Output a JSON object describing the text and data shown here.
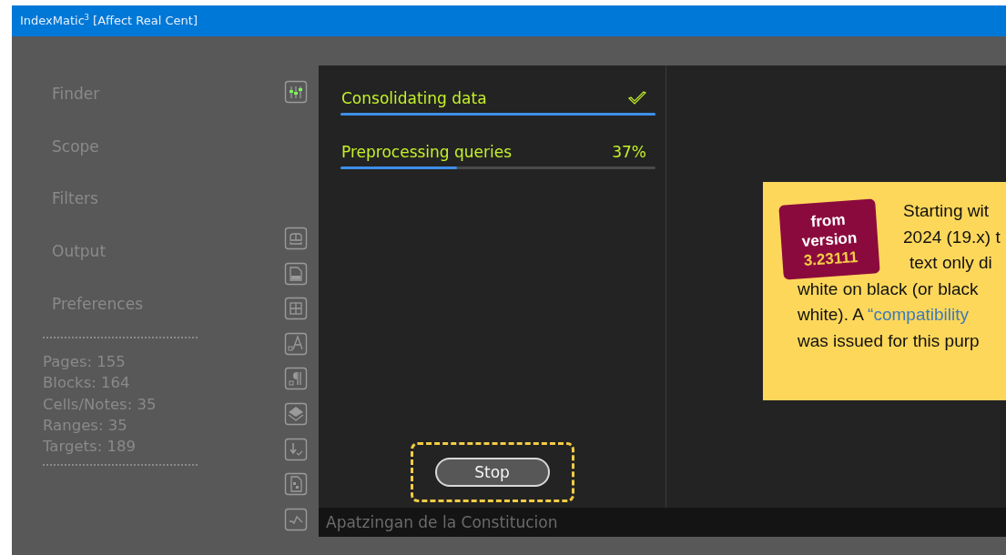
{
  "window": {
    "title": "IndexMatic$^{3}$ [Affect Real Cent]"
  },
  "sidebar": {
    "items": [
      {
        "label": "Finder"
      },
      {
        "label": "Scope"
      },
      {
        "label": "Filters"
      },
      {
        "label": "Output"
      },
      {
        "label": "Preferences"
      }
    ],
    "stats": [
      "Pages: 155",
      "Blocks: 164",
      "Cells/Notes: 35",
      "Ranges: 35",
      "Targets: 189"
    ]
  },
  "tasks": [
    {
      "label": "Consolidating data",
      "kind": "done",
      "level": 1
    },
    {
      "label": "Preprocessing queries",
      "kind": "progress",
      "reading": "37%",
      "level": 0.37
    }
  ],
  "stop_button": {
    "label": "Stop"
  },
  "status_bar": {
    "text": "Apatzingan de la Constitucion"
  },
  "callout": {
    "badge": {
      "lines": [
        "from",
        "version"
      ],
      "version": "3.23111"
    },
    "lines": [
      {
        "text": "Starting wit"
      },
      {
        "text": "2024 (19.x) t"
      },
      {
        "text": "text only di"
      },
      {
        "text": "white on black (or black"
      },
      {
        "text": "white). A ",
        "link": "“compatibility"
      },
      {
        "text": "was issued for this purp"
      }
    ]
  }
}
